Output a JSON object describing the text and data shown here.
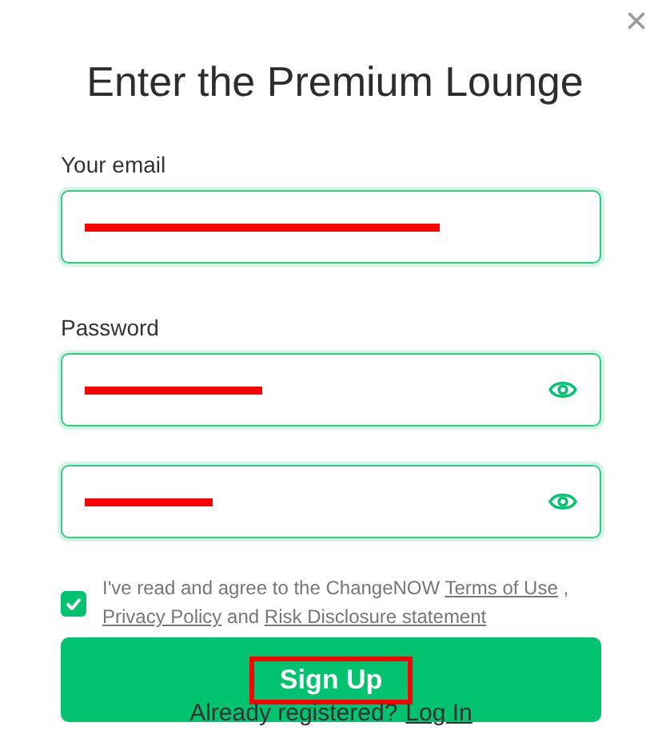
{
  "close": "×",
  "title": "Enter the Premium Lounge",
  "fields": [
    {
      "label": "Your email",
      "kind": "email"
    },
    {
      "label": "Password",
      "kind": "password"
    },
    {
      "kind": "password"
    }
  ],
  "agreement": {
    "checked": true,
    "text": "I've read and agree to the ChangeNOW",
    "terms": "Terms of Use",
    "comma": ",",
    "privacy": "Privacy Policy",
    "and": "and",
    "risk": "Risk Disclosure statement"
  },
  "submit": "Sign Up",
  "footer": {
    "text": "Already registered?",
    "link": "Log In"
  }
}
